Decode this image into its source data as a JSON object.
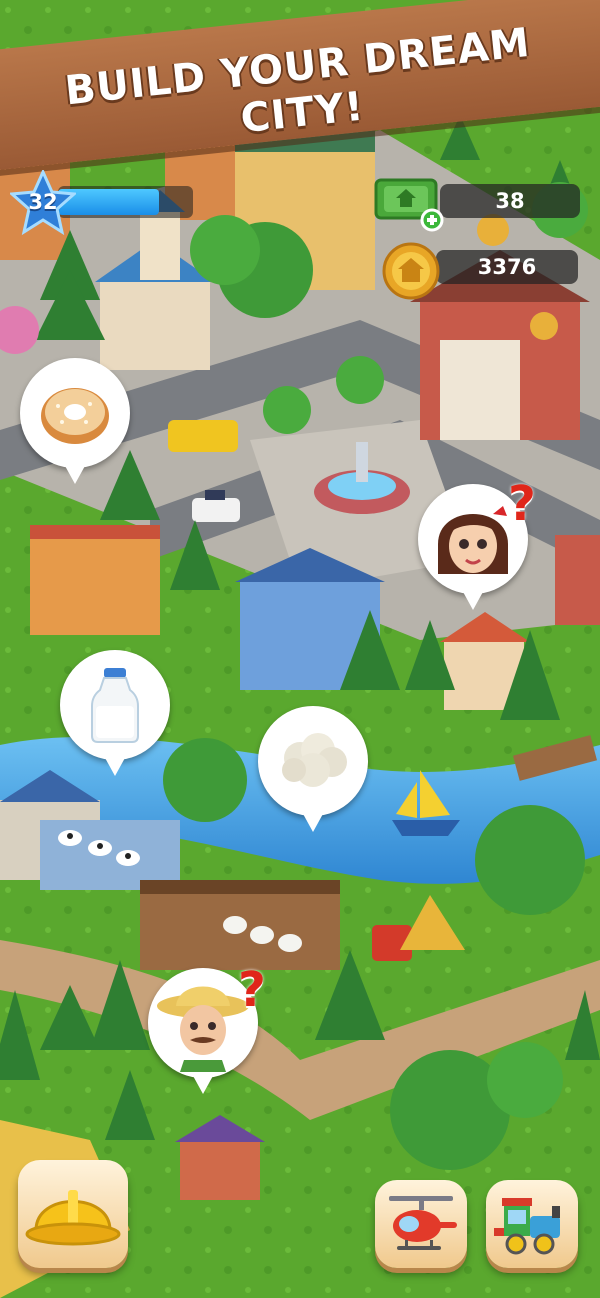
{
  "banner": {
    "title": "BUILD YOUR DREAM CITY!"
  },
  "hud": {
    "level": "32",
    "xp_progress": 0.75,
    "cash": "38",
    "coins": "3376"
  },
  "requests": [
    {
      "item": "donut",
      "icon": "donut-icon"
    },
    {
      "item": "girl-character",
      "icon": "question-icon"
    },
    {
      "item": "milk",
      "icon": "milk-bottle-icon"
    },
    {
      "item": "wool",
      "icon": "wool-icon"
    },
    {
      "item": "farmer-character",
      "icon": "question-icon"
    }
  ],
  "question_mark": "?",
  "bottom_bar": {
    "build_icon": "hard-hat-icon",
    "helicopter_icon": "helicopter-icon",
    "train_icon": "train-icon"
  },
  "colors": {
    "grass": "#5aa82e",
    "river": "#4aa0e6",
    "road": "#777a7e",
    "banner": "#a9683f",
    "xp_bar": "#1a8ee8"
  }
}
